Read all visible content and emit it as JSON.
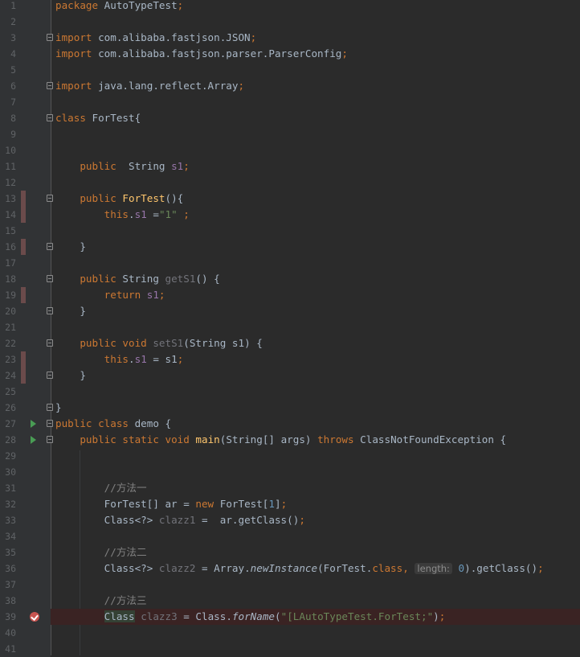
{
  "theme": {
    "background": "#2b2b2b",
    "gutter": "#313335",
    "keyword": "#cc7832",
    "string": "#6a8759",
    "number": "#6897bb",
    "field": "#9876aa",
    "method": "#ffc66d",
    "comment": "#808080",
    "breakpoint": "#c75450",
    "run": "#499c54"
  },
  "lines": [
    {
      "n": "1",
      "tokens": [
        [
          "kw",
          "package "
        ],
        [
          "plain",
          "AutoTypeTest"
        ],
        [
          "kw",
          ";"
        ]
      ]
    },
    {
      "n": "2",
      "tokens": []
    },
    {
      "n": "3",
      "fold": true,
      "tokens": [
        [
          "kw",
          "import "
        ],
        [
          "plain",
          "com.alibaba.fastjson.JSON"
        ],
        [
          "kw",
          ";"
        ]
      ]
    },
    {
      "n": "4",
      "tokens": [
        [
          "kw",
          "import "
        ],
        [
          "plain",
          "com.alibaba.fastjson.parser.ParserConfig"
        ],
        [
          "kw",
          ";"
        ]
      ]
    },
    {
      "n": "5",
      "tokens": []
    },
    {
      "n": "6",
      "fold": true,
      "tokens": [
        [
          "kw",
          "import "
        ],
        [
          "plain",
          "java.lang.reflect.Array"
        ],
        [
          "kw",
          ";"
        ]
      ]
    },
    {
      "n": "7",
      "tokens": []
    },
    {
      "n": "8",
      "fold": true,
      "tokens": [
        [
          "kw",
          "class "
        ],
        [
          "plain",
          "ForTest{"
        ]
      ]
    },
    {
      "n": "9",
      "tokens": []
    },
    {
      "n": "10",
      "tokens": []
    },
    {
      "n": "11",
      "tokens": [
        [
          "plain",
          "    "
        ],
        [
          "kw",
          "public  "
        ],
        [
          "plain",
          "String "
        ],
        [
          "fld",
          "s1"
        ],
        [
          "kw",
          ";"
        ]
      ]
    },
    {
      "n": "12",
      "tokens": []
    },
    {
      "n": "13",
      "fold": true,
      "mark": true,
      "tokens": [
        [
          "plain",
          "    "
        ],
        [
          "kw",
          "public "
        ],
        [
          "fn",
          "ForTest"
        ],
        [
          "plain",
          "(){"
        ]
      ]
    },
    {
      "n": "14",
      "mark": true,
      "tokens": [
        [
          "plain",
          "        "
        ],
        [
          "kw",
          "this"
        ],
        [
          "plain",
          "."
        ],
        [
          "fld",
          "s1"
        ],
        [
          "plain",
          " ="
        ],
        [
          "str",
          "\"1\""
        ],
        [
          "plain",
          " "
        ],
        [
          "kw",
          ";"
        ]
      ]
    },
    {
      "n": "15",
      "tokens": []
    },
    {
      "n": "16",
      "fold": true,
      "mark": true,
      "tokens": [
        [
          "plain",
          "    }"
        ]
      ]
    },
    {
      "n": "17",
      "tokens": []
    },
    {
      "n": "18",
      "fold": true,
      "tokens": [
        [
          "plain",
          "    "
        ],
        [
          "kw",
          "public "
        ],
        [
          "plain",
          "String "
        ],
        [
          "unused",
          "getS1"
        ],
        [
          "plain",
          "() {"
        ]
      ]
    },
    {
      "n": "19",
      "mark": true,
      "tokens": [
        [
          "plain",
          "        "
        ],
        [
          "kw",
          "return "
        ],
        [
          "fld",
          "s1"
        ],
        [
          "kw",
          ";"
        ]
      ]
    },
    {
      "n": "20",
      "fold": true,
      "tokens": [
        [
          "plain",
          "    }"
        ]
      ]
    },
    {
      "n": "21",
      "tokens": []
    },
    {
      "n": "22",
      "fold": true,
      "tokens": [
        [
          "plain",
          "    "
        ],
        [
          "kw",
          "public void "
        ],
        [
          "unused",
          "setS1"
        ],
        [
          "plain",
          "(String s1) {"
        ]
      ]
    },
    {
      "n": "23",
      "mark": true,
      "tokens": [
        [
          "plain",
          "        "
        ],
        [
          "kw",
          "this"
        ],
        [
          "plain",
          "."
        ],
        [
          "fld",
          "s1"
        ],
        [
          "plain",
          " = s1"
        ],
        [
          "kw",
          ";"
        ]
      ]
    },
    {
      "n": "24",
      "fold": true,
      "mark": true,
      "tokens": [
        [
          "plain",
          "    }"
        ]
      ]
    },
    {
      "n": "25",
      "tokens": []
    },
    {
      "n": "26",
      "fold": true,
      "tokens": [
        [
          "plain",
          "}"
        ]
      ]
    },
    {
      "n": "27",
      "run": true,
      "fold": true,
      "tokens": [
        [
          "kw",
          "public class "
        ],
        [
          "plain",
          "demo {"
        ]
      ]
    },
    {
      "n": "28",
      "run": true,
      "fold": true,
      "tokens": [
        [
          "plain",
          "    "
        ],
        [
          "kw",
          "public static void "
        ],
        [
          "fn",
          "main"
        ],
        [
          "plain",
          "(String[] args) "
        ],
        [
          "kw",
          "throws "
        ],
        [
          "plain",
          "ClassNotFoundException {"
        ]
      ]
    },
    {
      "n": "29",
      "tokens": []
    },
    {
      "n": "30",
      "tokens": []
    },
    {
      "n": "31",
      "tokens": [
        [
          "plain",
          "        "
        ],
        [
          "cmt",
          "//方法一"
        ]
      ]
    },
    {
      "n": "32",
      "tokens": [
        [
          "plain",
          "        ForTest[] ar = "
        ],
        [
          "kw",
          "new "
        ],
        [
          "plain",
          "ForTest["
        ],
        [
          "num",
          "1"
        ],
        [
          "plain",
          "]"
        ],
        [
          "kw",
          ";"
        ]
      ]
    },
    {
      "n": "33",
      "tokens": [
        [
          "plain",
          "        Class<?> "
        ],
        [
          "unused",
          "clazz1"
        ],
        [
          "plain",
          " =  ar.getClass()"
        ],
        [
          "kw",
          ";"
        ]
      ]
    },
    {
      "n": "34",
      "tokens": []
    },
    {
      "n": "35",
      "tokens": [
        [
          "plain",
          "        "
        ],
        [
          "cmt",
          "//方法二"
        ]
      ]
    },
    {
      "n": "36",
      "tokens": [
        [
          "plain",
          "        Class<?> "
        ],
        [
          "unused",
          "clazz2"
        ],
        [
          "plain",
          " = Array."
        ],
        [
          "ital",
          "newInstance"
        ],
        [
          "plain",
          "(ForTest."
        ],
        [
          "kw",
          "class, "
        ],
        [
          "hint",
          "length:"
        ],
        [
          "plain",
          " "
        ],
        [
          "num",
          "0"
        ],
        [
          "plain",
          ").getClass()"
        ],
        [
          "kw",
          ";"
        ]
      ]
    },
    {
      "n": "37",
      "tokens": []
    },
    {
      "n": "38",
      "tokens": [
        [
          "plain",
          "        "
        ],
        [
          "cmt",
          "//方法三"
        ]
      ]
    },
    {
      "n": "39",
      "breakpoint": true,
      "current": true,
      "tokens": [
        [
          "plain",
          "        "
        ],
        [
          "hl",
          "Class"
        ],
        [
          "plain",
          " "
        ],
        [
          "unused",
          "clazz3"
        ],
        [
          "plain",
          " = Class."
        ],
        [
          "ital",
          "forName"
        ],
        [
          "plain",
          "("
        ],
        [
          "str",
          "\"[LAutoTypeTest.ForTest;\""
        ],
        [
          "plain",
          ")"
        ],
        [
          "kw",
          ";"
        ]
      ]
    },
    {
      "n": "40",
      "tokens": []
    },
    {
      "n": "41",
      "tokens": []
    }
  ]
}
